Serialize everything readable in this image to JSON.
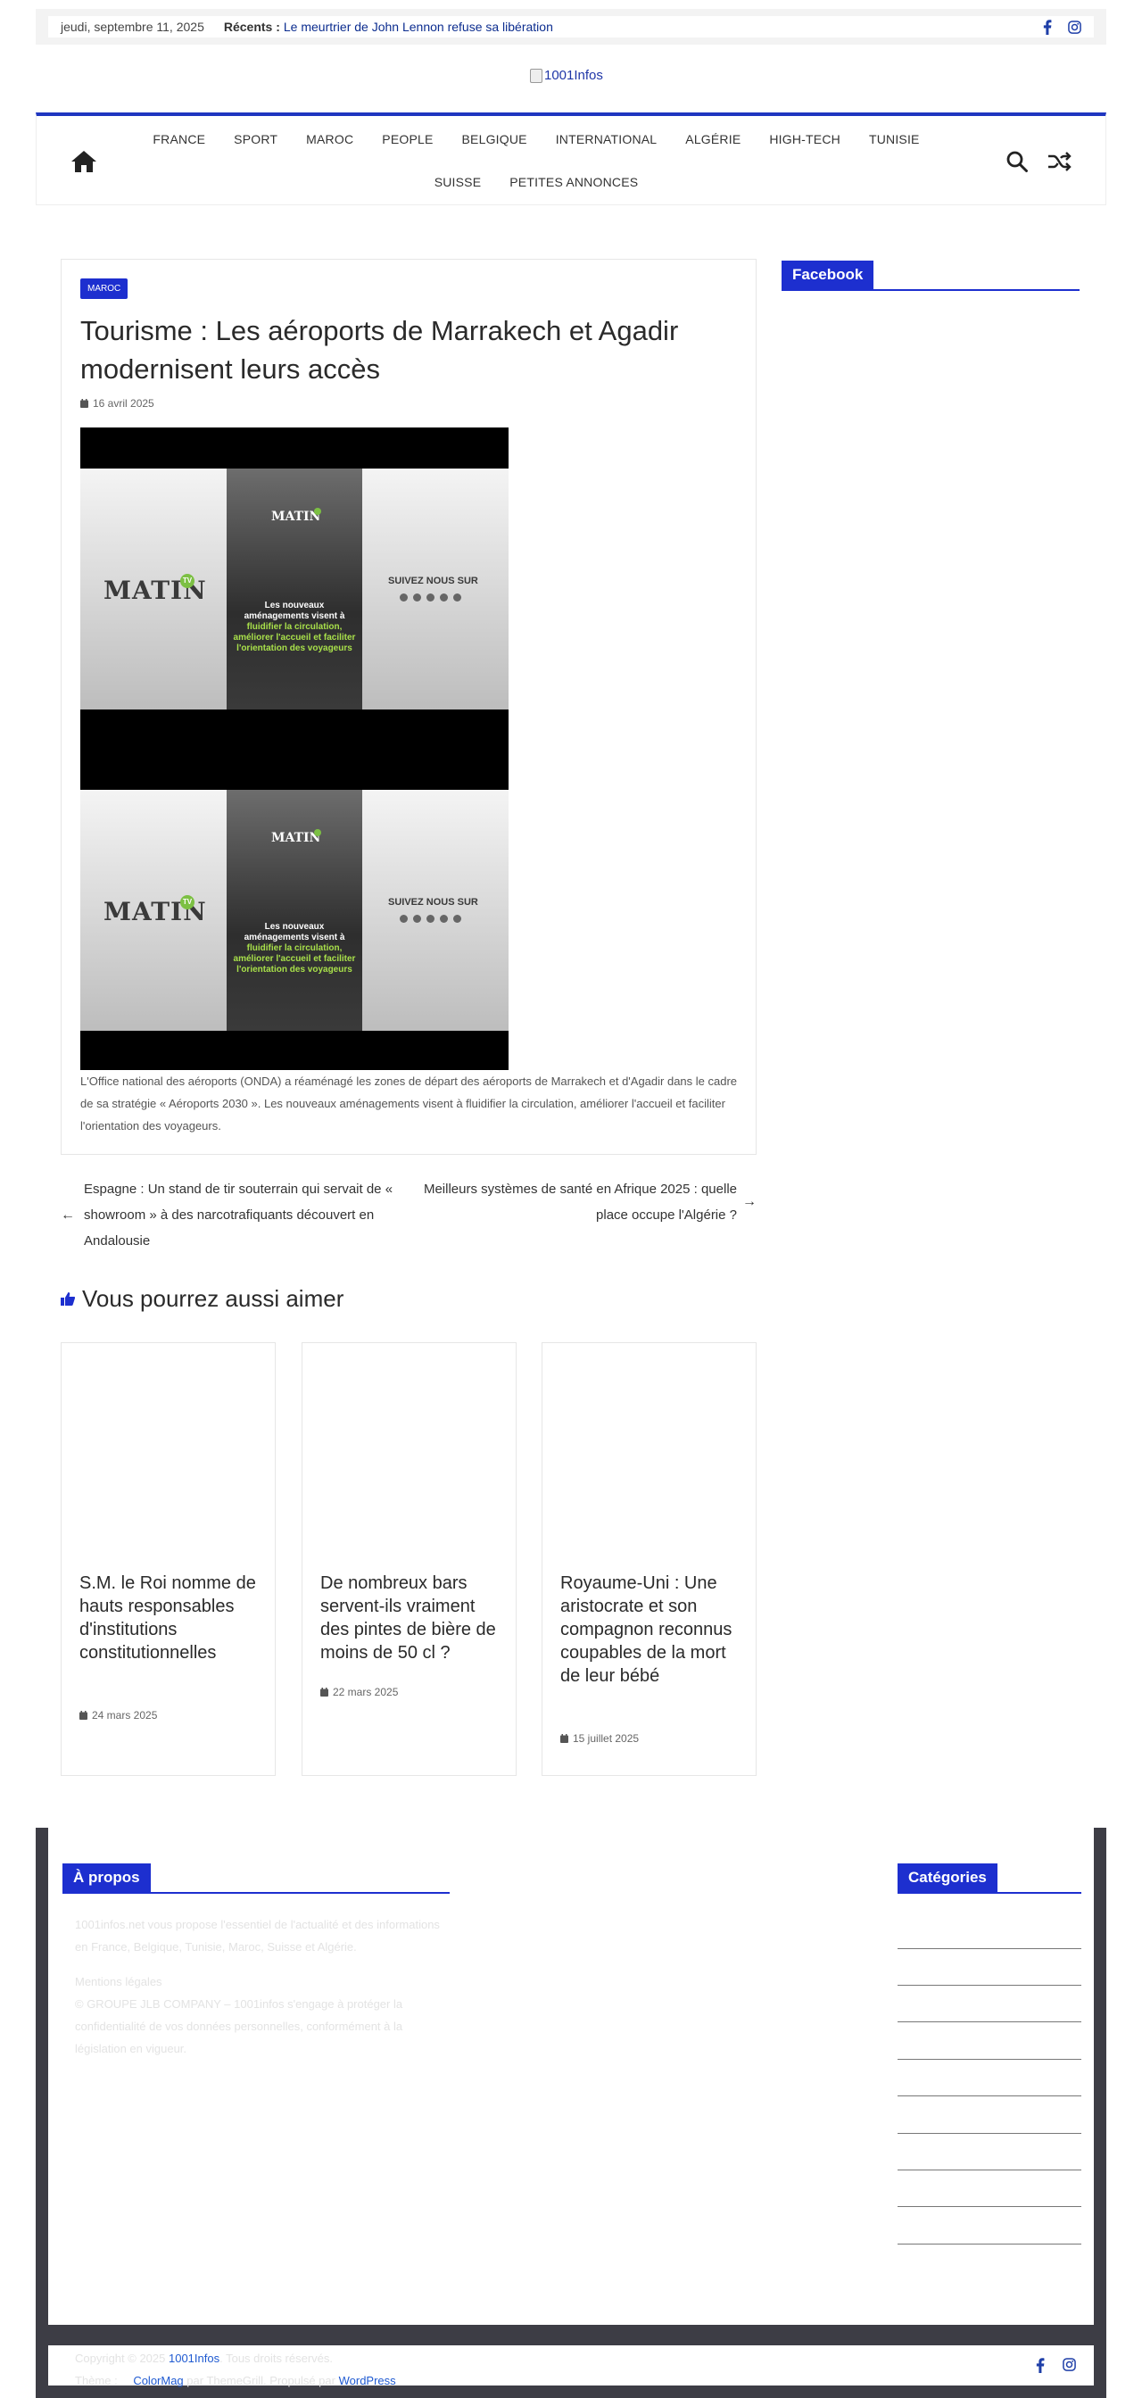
{
  "topbar": {
    "date": "jeudi, septembre 11, 2025",
    "recent_label": "Récents :",
    "recent_link": "Le meurtrier de John Lennon refuse sa libération",
    "social": [
      "facebook-icon",
      "instagram-icon"
    ]
  },
  "logo": {
    "alt": "1001Infos"
  },
  "nav": {
    "items": [
      "FRANCE",
      "SPORT",
      "MAROC",
      "PEOPLE",
      "BELGIQUE",
      "INTERNATIONAL",
      "ALGÉRIE",
      "HIGH-TECH",
      "TUNISIE",
      "SUISSE",
      "PETITES ANNONCES"
    ],
    "icons": [
      "home-icon",
      "search-icon",
      "shuffle-icon"
    ]
  },
  "article": {
    "category": "MAROC",
    "title": "Tourisme : Les aéroports de Marrakech et Agadir modernisent leurs accès",
    "date": "16 avril 2025",
    "video": {
      "brand": "MATIN",
      "brand_badge": "TV",
      "caption_white": "Les nouveaux aménagements visent à ",
      "caption_green": "fluidifier la circulation, améliorer l'accueil et faciliter l'orientation des voyageurs",
      "follow": "SUIVEZ NOUS SUR"
    },
    "body": "L'Office national des aéroports (ONDA) a réaménagé les zones de départ des aéroports de Marrakech et d'Agadir dans le cadre de sa stratégie « Aéroports 2030 ». Les nouveaux aménagements visent à fluidifier la circulation, améliorer l'accueil et faciliter l'orientation des voyageurs."
  },
  "post_nav": {
    "prev": "Espagne : Un stand de tir souterrain qui servait de « showroom » à des narcotrafiquants découvert en Andalousie",
    "next": "Meilleurs systèmes de santé en Afrique 2025 : quelle place occupe l'Algérie ?"
  },
  "related": {
    "heading": "Vous pourrez aussi aimer",
    "items": [
      {
        "title": "S.M. le Roi nomme de hauts responsables d'institutions constitutionnelles",
        "date": "24 mars 2025"
      },
      {
        "title": "De nombreux bars servent-ils vraiment des pintes de bière de moins de 50 cl ?",
        "date": "22 mars 2025"
      },
      {
        "title": "Royaume-Uni : Une aristocrate et son compagnon reconnus coupables de la mort de leur bébé",
        "date": "15 juillet 2025"
      }
    ]
  },
  "sidebar": {
    "facebook_title": "Facebook"
  },
  "footer": {
    "about_title": "À propos",
    "about_text": "1001infos.net vous propose l'essentiel de l'actualité et des informations en France, Belgique, Tunisie, Maroc, Suisse et Algérie.",
    "legal_title": "Mentions légales",
    "legal_text": "© GROUPE JLB COMPANY – 1001infos s'engage à protéger la confidentialité de vos données personnelles, conformément à la législation en vigueur.",
    "categories_title": "Catégories",
    "copyright_prefix": "Copyright © 2025",
    "copyright_site": "1001Infos",
    "copyright_suffix": ". Tous droits réservés.",
    "theme_prefix": "Thème :",
    "theme_name": "ColorMag",
    "theme_mid": "par ThemeGrill. Propulsé par",
    "theme_wp": "WordPress",
    "accent": "#1d2fcf"
  }
}
